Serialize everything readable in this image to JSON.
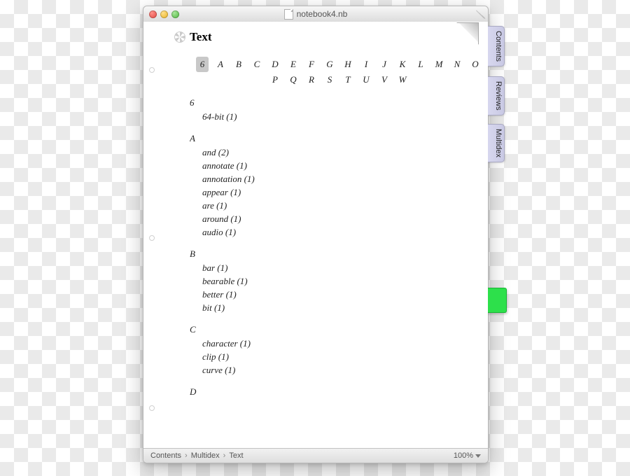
{
  "window": {
    "title": "notebook4.nb"
  },
  "page": {
    "heading": "Text"
  },
  "side_tabs": [
    {
      "label": "Contents"
    },
    {
      "label": "Reviews"
    },
    {
      "label": "Multidex"
    }
  ],
  "alphabet": {
    "row1": [
      "6",
      "A",
      "B",
      "C",
      "D",
      "E",
      "F",
      "G",
      "H",
      "I",
      "J",
      "K",
      "L",
      "M",
      "N",
      "O"
    ],
    "row2": [
      "P",
      "Q",
      "R",
      "S",
      "T",
      "U",
      "V",
      "W"
    ],
    "selected": "6"
  },
  "index": [
    {
      "letter": "6",
      "entries": [
        {
          "term": "64-bit",
          "count": 1
        }
      ]
    },
    {
      "letter": "A",
      "entries": [
        {
          "term": "and",
          "count": 2
        },
        {
          "term": "annotate",
          "count": 1
        },
        {
          "term": "annotation",
          "count": 1
        },
        {
          "term": "appear",
          "count": 1
        },
        {
          "term": "are",
          "count": 1
        },
        {
          "term": "around",
          "count": 1
        },
        {
          "term": "audio",
          "count": 1
        }
      ]
    },
    {
      "letter": "B",
      "entries": [
        {
          "term": "bar",
          "count": 1
        },
        {
          "term": "bearable",
          "count": 1
        },
        {
          "term": "better",
          "count": 1
        },
        {
          "term": "bit",
          "count": 1
        }
      ]
    },
    {
      "letter": "C",
      "entries": [
        {
          "term": "character",
          "count": 1
        },
        {
          "term": "clip",
          "count": 1
        },
        {
          "term": "curve",
          "count": 1
        }
      ]
    },
    {
      "letter": "D",
      "entries": []
    }
  ],
  "status": {
    "breadcrumb": [
      "Contents",
      "Multidex",
      "Text"
    ],
    "zoom": "100%"
  }
}
